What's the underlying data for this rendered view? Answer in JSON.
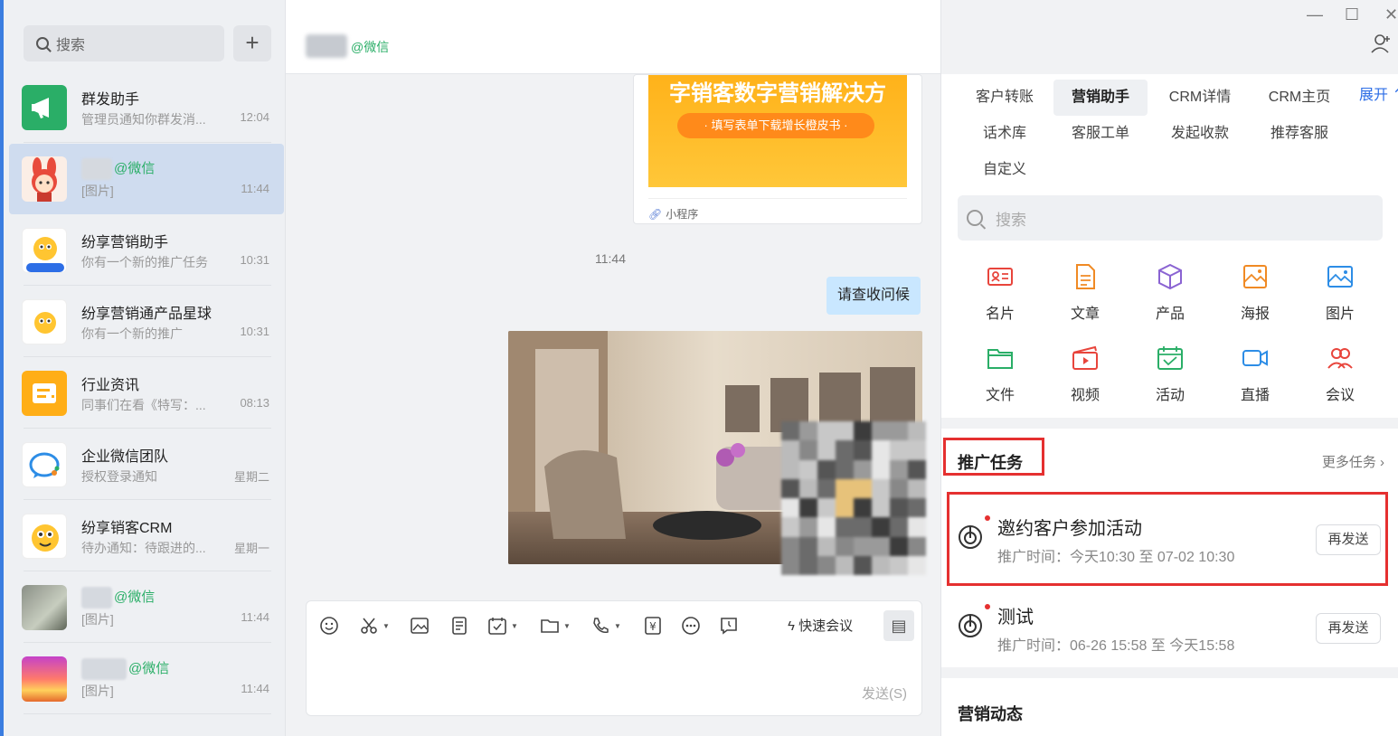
{
  "search": {
    "placeholder": "搜索",
    "add_icon": "plus-icon"
  },
  "conversations": [
    {
      "name": "群发助手",
      "preview": "管理员通知你群发消...",
      "time": "12:04"
    },
    {
      "name_suffix": "@微信",
      "preview": "[图片]",
      "time": "11:44",
      "selected": true
    },
    {
      "name": "纷享营销助手",
      "preview": "你有一个新的推广任务",
      "time": "10:31"
    },
    {
      "name": "纷享营销通产品星球",
      "preview": "你有一个新的推广",
      "time": "10:31"
    },
    {
      "name": "行业资讯",
      "preview": "同事们在看《特写：...",
      "time": "08:13"
    },
    {
      "name": "企业微信团队",
      "preview": "授权登录通知",
      "time": "星期二"
    },
    {
      "name": "纷享销客CRM",
      "preview": "待办通知：待跟进的...",
      "time": "星期一"
    },
    {
      "name_suffix": "@微信",
      "preview": "[图片]",
      "time": "11:44"
    },
    {
      "name_suffix": "@微信",
      "preview": "[图片]",
      "time": "11:44"
    }
  ],
  "chat": {
    "header_suffix": "@微信",
    "mini_program": {
      "banner_title": "字销客数字营销解决方",
      "banner_button": "· 填写表单下载增长橙皮书 ·",
      "footer_label": "小程序"
    },
    "timestamp": "11:44",
    "outgoing_message": "请查收问候",
    "toolbar": {
      "quick_meeting": "快速会议",
      "send": "发送(S)"
    }
  },
  "sidebar": {
    "tabs_row1": [
      "客户转账",
      "营销助手",
      "CRM详情",
      "CRM主页"
    ],
    "expand_label": "展开",
    "tabs_row2": [
      "话术库",
      "客服工单",
      "发起收款",
      "推荐客服"
    ],
    "tabs_row3": [
      "自定义"
    ],
    "active_tab": "营销助手",
    "search_placeholder": "搜索",
    "tools_row1": [
      {
        "label": "名片",
        "icon": "card-icon",
        "color": "#e8453c"
      },
      {
        "label": "文章",
        "icon": "article-icon",
        "color": "#f08a24"
      },
      {
        "label": "产品",
        "icon": "product-cube-icon",
        "color": "#8a63d2"
      },
      {
        "label": "海报",
        "icon": "poster-icon",
        "color": "#f08a24"
      },
      {
        "label": "图片",
        "icon": "image-icon",
        "color": "#2d8de6"
      }
    ],
    "tools_row2": [
      {
        "label": "文件",
        "icon": "folder-icon",
        "color": "#2aae67"
      },
      {
        "label": "视频",
        "icon": "video-clapper-icon",
        "color": "#e8453c"
      },
      {
        "label": "活动",
        "icon": "calendar-icon",
        "color": "#2aae67"
      },
      {
        "label": "直播",
        "icon": "live-camera-icon",
        "color": "#2d8de6"
      },
      {
        "label": "会议",
        "icon": "meeting-people-icon",
        "color": "#e8453c"
      }
    ],
    "tasks_title": "推广任务",
    "more_tasks": "更多任务",
    "tasks": [
      {
        "name": "邀约客户参加活动",
        "time": "推广时间：今天10:30 至 07-02 10:30",
        "action": "再发送"
      },
      {
        "name": "测试",
        "time": "推广时间：06-26 15:58 至 今天15:58",
        "action": "再发送"
      }
    ],
    "dynamics_title": "营销动态"
  },
  "window": {
    "minimize": "—",
    "maximize": "☐",
    "close": "✕"
  }
}
